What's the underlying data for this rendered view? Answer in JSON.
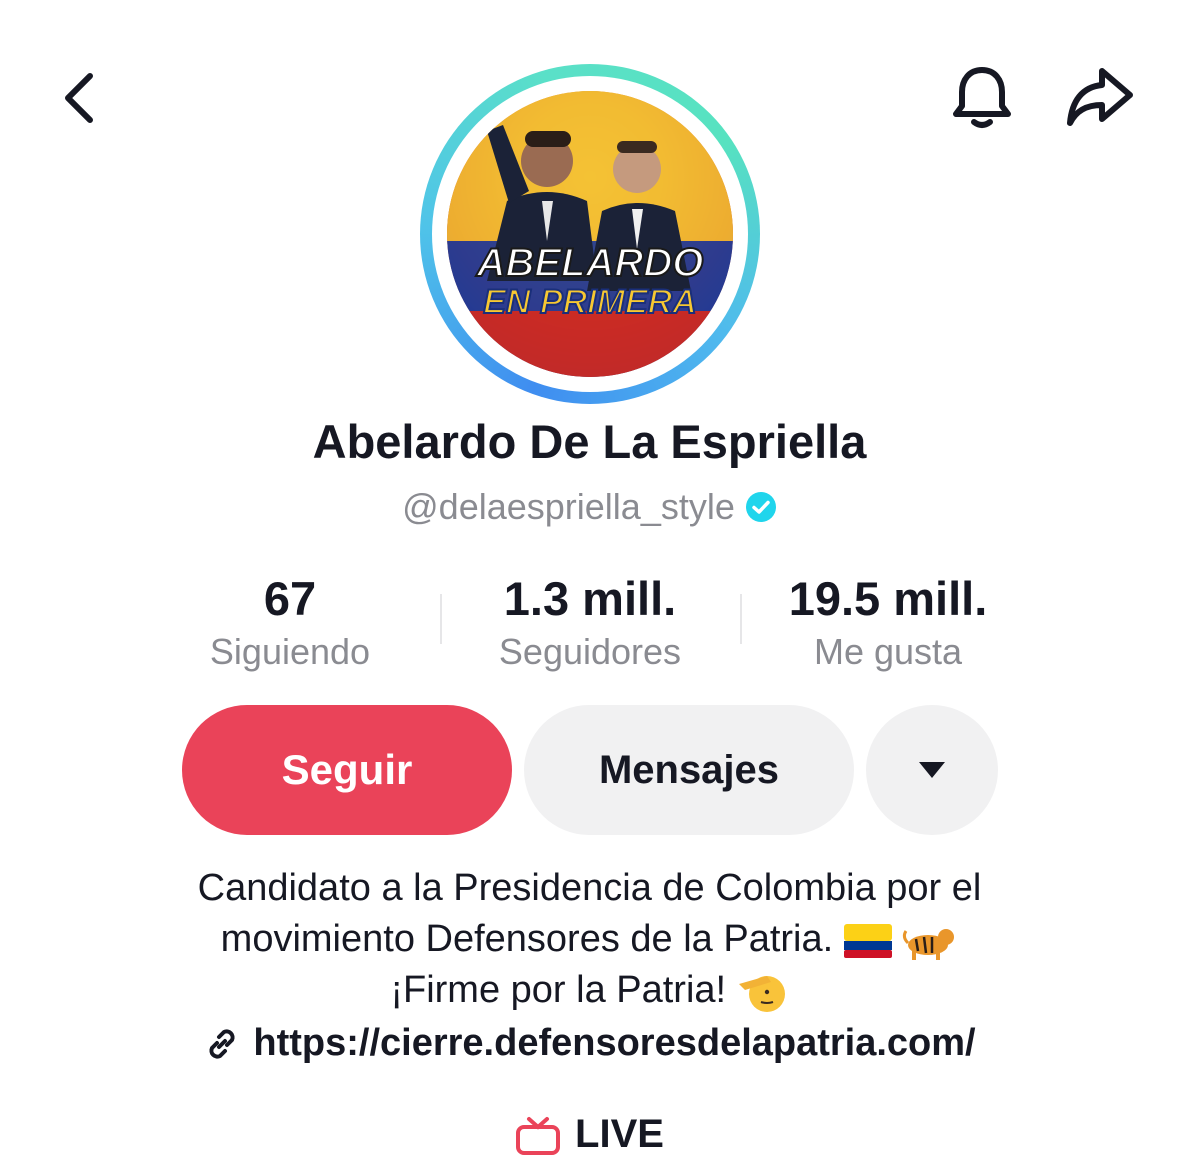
{
  "header": {
    "back_icon": "chevron-left-icon",
    "bell_icon": "bell-icon",
    "share_icon": "share-arrow-icon"
  },
  "profile": {
    "avatar_title": "ABELARDO",
    "avatar_subtitle": "EN PRIMERA",
    "display_name": "Abelardo De La Espriella",
    "handle": "@delaespriella_style",
    "verified": true
  },
  "stats": {
    "following_count": "67",
    "following_label": "Siguiendo",
    "followers_count": "1.3 mill.",
    "followers_label": "Seguidores",
    "likes_count": "19.5 mill.",
    "likes_label": "Me gusta"
  },
  "actions": {
    "follow_label": "Seguir",
    "message_label": "Mensajes",
    "more_icon": "caret-down-icon"
  },
  "bio": {
    "line1": "Candidato a la Presidencia de Colombia por el",
    "line2": "movimiento Defensores de la Patria.",
    "line3": "¡Firme por la Patria!",
    "link": "https://cierre.defensoresdelapatria.com/"
  },
  "live": {
    "label": "LIVE"
  },
  "colors": {
    "follow_button": "#ea4359",
    "secondary_button": "#f1f1f2",
    "verified_badge": "#20d5ec",
    "muted_text": "#8a8b91"
  }
}
